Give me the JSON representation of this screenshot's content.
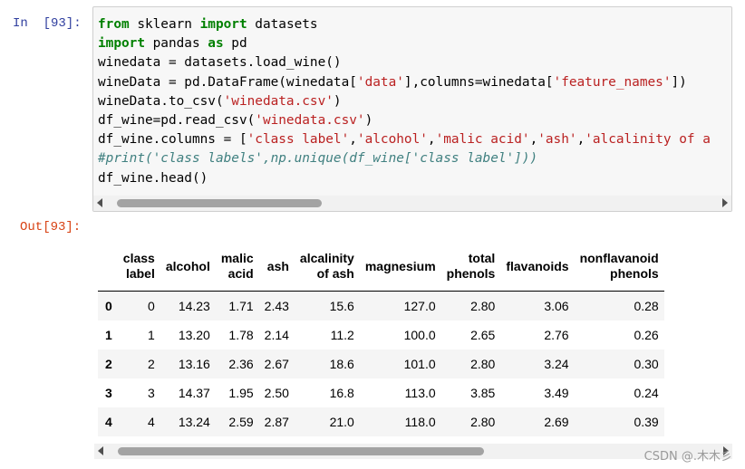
{
  "cell": {
    "input_prompt": "In  [93]:",
    "output_prompt": "Out[93]:",
    "code_lines": [
      [
        {
          "t": "from",
          "c": "kw"
        },
        {
          "t": " sklearn ",
          "c": ""
        },
        {
          "t": "import",
          "c": "kw"
        },
        {
          "t": " datasets",
          "c": ""
        }
      ],
      [
        {
          "t": "import",
          "c": "kw"
        },
        {
          "t": " pandas ",
          "c": ""
        },
        {
          "t": "as",
          "c": "kw"
        },
        {
          "t": " pd",
          "c": ""
        }
      ],
      [
        {
          "t": "winedata = datasets.load_wine()",
          "c": ""
        }
      ],
      [
        {
          "t": "wineData = pd.DataFrame(winedata[",
          "c": ""
        },
        {
          "t": "'data'",
          "c": "str"
        },
        {
          "t": "],columns=winedata[",
          "c": ""
        },
        {
          "t": "'feature_names'",
          "c": "str"
        },
        {
          "t": "])",
          "c": ""
        }
      ],
      [
        {
          "t": "wineData.to_csv(",
          "c": ""
        },
        {
          "t": "'winedata.csv'",
          "c": "str"
        },
        {
          "t": ")",
          "c": ""
        }
      ],
      [
        {
          "t": "df_wine=pd.read_csv(",
          "c": ""
        },
        {
          "t": "'winedata.csv'",
          "c": "str"
        },
        {
          "t": ")",
          "c": ""
        }
      ],
      [
        {
          "t": "df_wine.columns = [",
          "c": ""
        },
        {
          "t": "'class label'",
          "c": "str"
        },
        {
          "t": ",",
          "c": ""
        },
        {
          "t": "'alcohol'",
          "c": "str"
        },
        {
          "t": ",",
          "c": ""
        },
        {
          "t": "'malic acid'",
          "c": "str"
        },
        {
          "t": ",",
          "c": ""
        },
        {
          "t": "'ash'",
          "c": "str"
        },
        {
          "t": ",",
          "c": ""
        },
        {
          "t": "'alcalinity of a",
          "c": "str"
        }
      ],
      [
        {
          "t": "#print('class labels',np.unique(df_wine['class label']))",
          "c": "cmt"
        }
      ],
      [
        {
          "t": "df_wine.head()",
          "c": ""
        }
      ]
    ]
  },
  "table": {
    "columns": [
      "",
      "class\nlabel",
      "alcohol",
      "malic\nacid",
      "ash",
      "alcalinity\nof ash",
      "magnesium",
      "total\nphenols",
      "flavanoids",
      "nonflavanoid\nphenols"
    ],
    "rows": [
      [
        "0",
        "0",
        "14.23",
        "1.71",
        "2.43",
        "15.6",
        "127.0",
        "2.80",
        "3.06",
        "0.28"
      ],
      [
        "1",
        "1",
        "13.20",
        "1.78",
        "2.14",
        "11.2",
        "100.0",
        "2.65",
        "2.76",
        "0.26"
      ],
      [
        "2",
        "2",
        "13.16",
        "2.36",
        "2.67",
        "18.6",
        "101.0",
        "2.80",
        "3.24",
        "0.30"
      ],
      [
        "3",
        "3",
        "14.37",
        "1.95",
        "2.50",
        "16.8",
        "113.0",
        "3.85",
        "3.49",
        "0.24"
      ],
      [
        "4",
        "4",
        "13.24",
        "2.59",
        "2.87",
        "21.0",
        "118.0",
        "2.80",
        "2.69",
        "0.39"
      ]
    ]
  },
  "watermark": "CSDN @.木木彡",
  "icons": {
    "scroll_left": "scroll-left-arrow-icon",
    "scroll_right": "scroll-right-arrow-icon"
  }
}
